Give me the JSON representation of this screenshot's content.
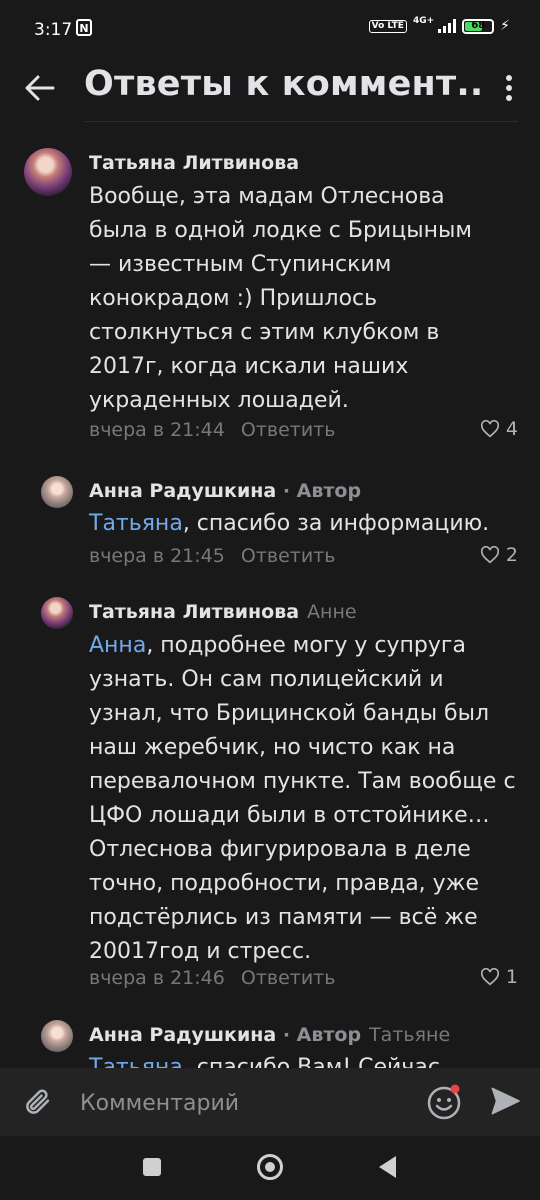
{
  "status_bar": {
    "time": "3:17",
    "nfc_label": "N",
    "volte": "Vo LTE",
    "network": "4G+",
    "battery": "68"
  },
  "header": {
    "title": "Ответы к коммент..."
  },
  "comments": [
    {
      "author": "Татьяна Литвинова",
      "role": "",
      "reply_to": "",
      "mention": "",
      "text": "Вообще, эта мадам Отлеснова была в одной лодке с Брицыным — известным Ступинским конокрадом :) Пришлось столкнуться с этим клубком в 2017г, когда искали наших украденных лошадей.",
      "time": "вчера в 21:44",
      "reply_label": "Ответить",
      "likes": "4"
    },
    {
      "author": "Анна Радушкина",
      "role": "· Автор",
      "reply_to": "",
      "mention": "Татьяна",
      "text": ", спасибо за информацию.",
      "time": "вчера в 21:45",
      "reply_label": "Ответить",
      "likes": "2"
    },
    {
      "author": "Татьяна Литвинова",
      "role": "",
      "reply_to": "Анне",
      "mention": "Анна",
      "text": ", подробнее могу у супруга узнать. Он сам полицейский и узнал, что Брицинской банды был наш жеребчик, но чисто как на перевалочном пункте. Там вообще с ЦФО лошади были в отстойнике… Отлеснова фигурировала в деле точно, подробности, правда, уже подстёрлись из памяти — всё же 20017год и стресс.",
      "time": "вчера в 21:46",
      "reply_label": "Ответить",
      "likes": "1"
    },
    {
      "author": "Анна Радушкина",
      "role": "· Автор",
      "reply_to": "Татьяне",
      "mention": "Татьяна",
      "text": ", спасибо Вам! Сейчас",
      "time": "",
      "reply_label": "",
      "likes": ""
    }
  ],
  "composer": {
    "placeholder": "Комментарий"
  },
  "colors": {
    "background": "#19191a",
    "accent_link": "#71aaeb",
    "muted_text": "#76787a",
    "notification_dot": "#e64646"
  }
}
